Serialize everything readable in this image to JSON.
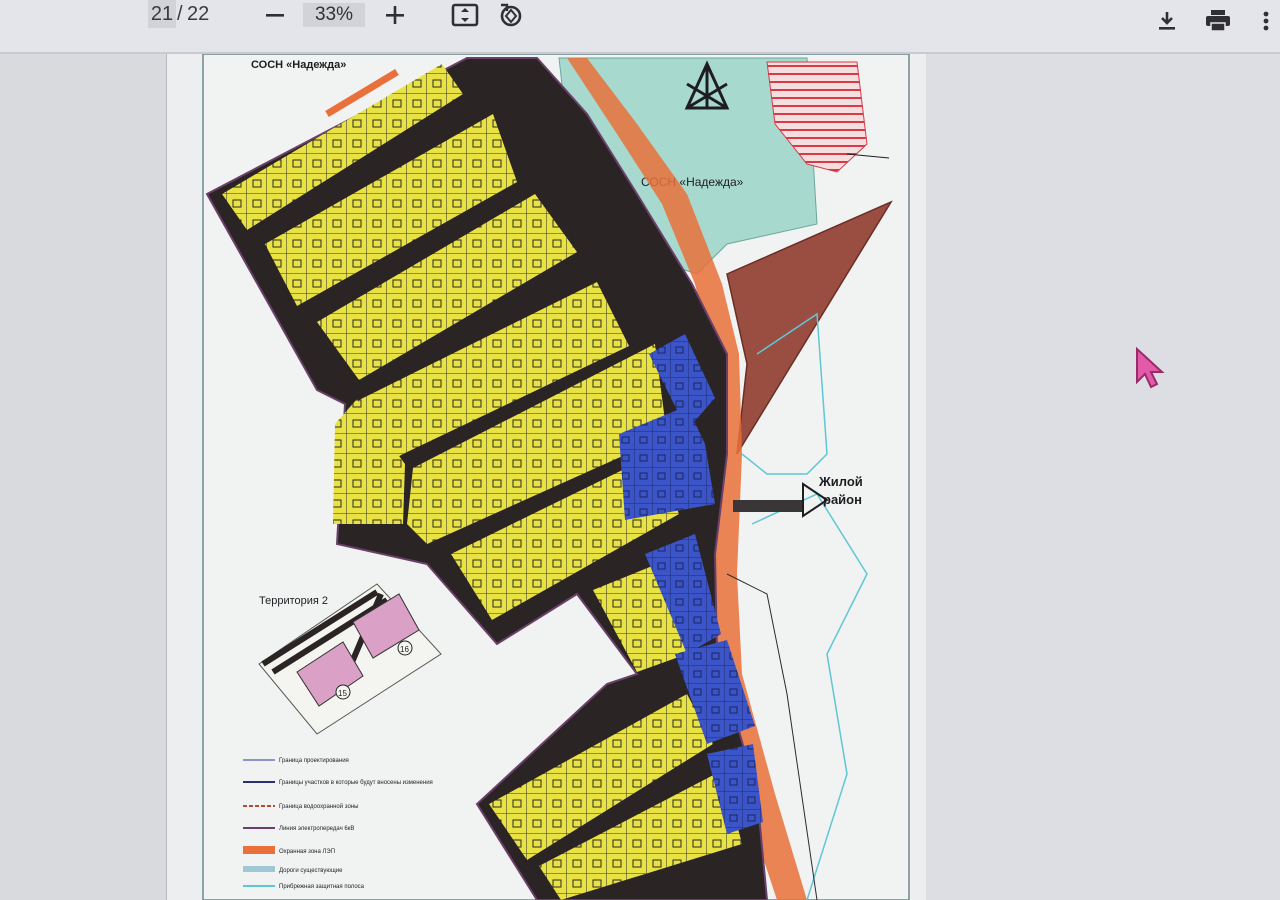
{
  "viewer": {
    "page_current": "21",
    "page_separator": "/",
    "page_total": "22",
    "zoom": "33%",
    "icons": {
      "zoom_out": "minus-icon",
      "zoom_in": "plus-icon",
      "fit": "fit-page-icon",
      "rotate": "rotate-icon",
      "download": "download-icon",
      "print": "print-icon",
      "more": "more-vertical-icon"
    }
  },
  "map": {
    "top_left_label": "СОСН «Надежда»",
    "center_label": "СОСН «Надежда»",
    "inset_title": "Территория 2",
    "inset_plot_a": "15",
    "inset_plot_b": "16",
    "district_label_line1": "Жилой",
    "district_label_line2": "район",
    "legend": [
      {
        "text": "Граница проектирования"
      },
      {
        "text": "Границы участков в которые будут вносены изменения"
      },
      {
        "text": "Граница водоохранной зоны"
      },
      {
        "text": "Линия электропередач 6кВ"
      },
      {
        "text": "Охранная зона ЛЭП"
      },
      {
        "text": "Дороги существующие"
      },
      {
        "text": "Прибрежная защитная полоса"
      }
    ],
    "colors": {
      "residential": "#e9e244",
      "public": "#3b55c8",
      "road": "#2a2323",
      "forest": "#a8d9cf",
      "power_zone": "#e9703a",
      "wedge": "#9a4e42"
    }
  }
}
